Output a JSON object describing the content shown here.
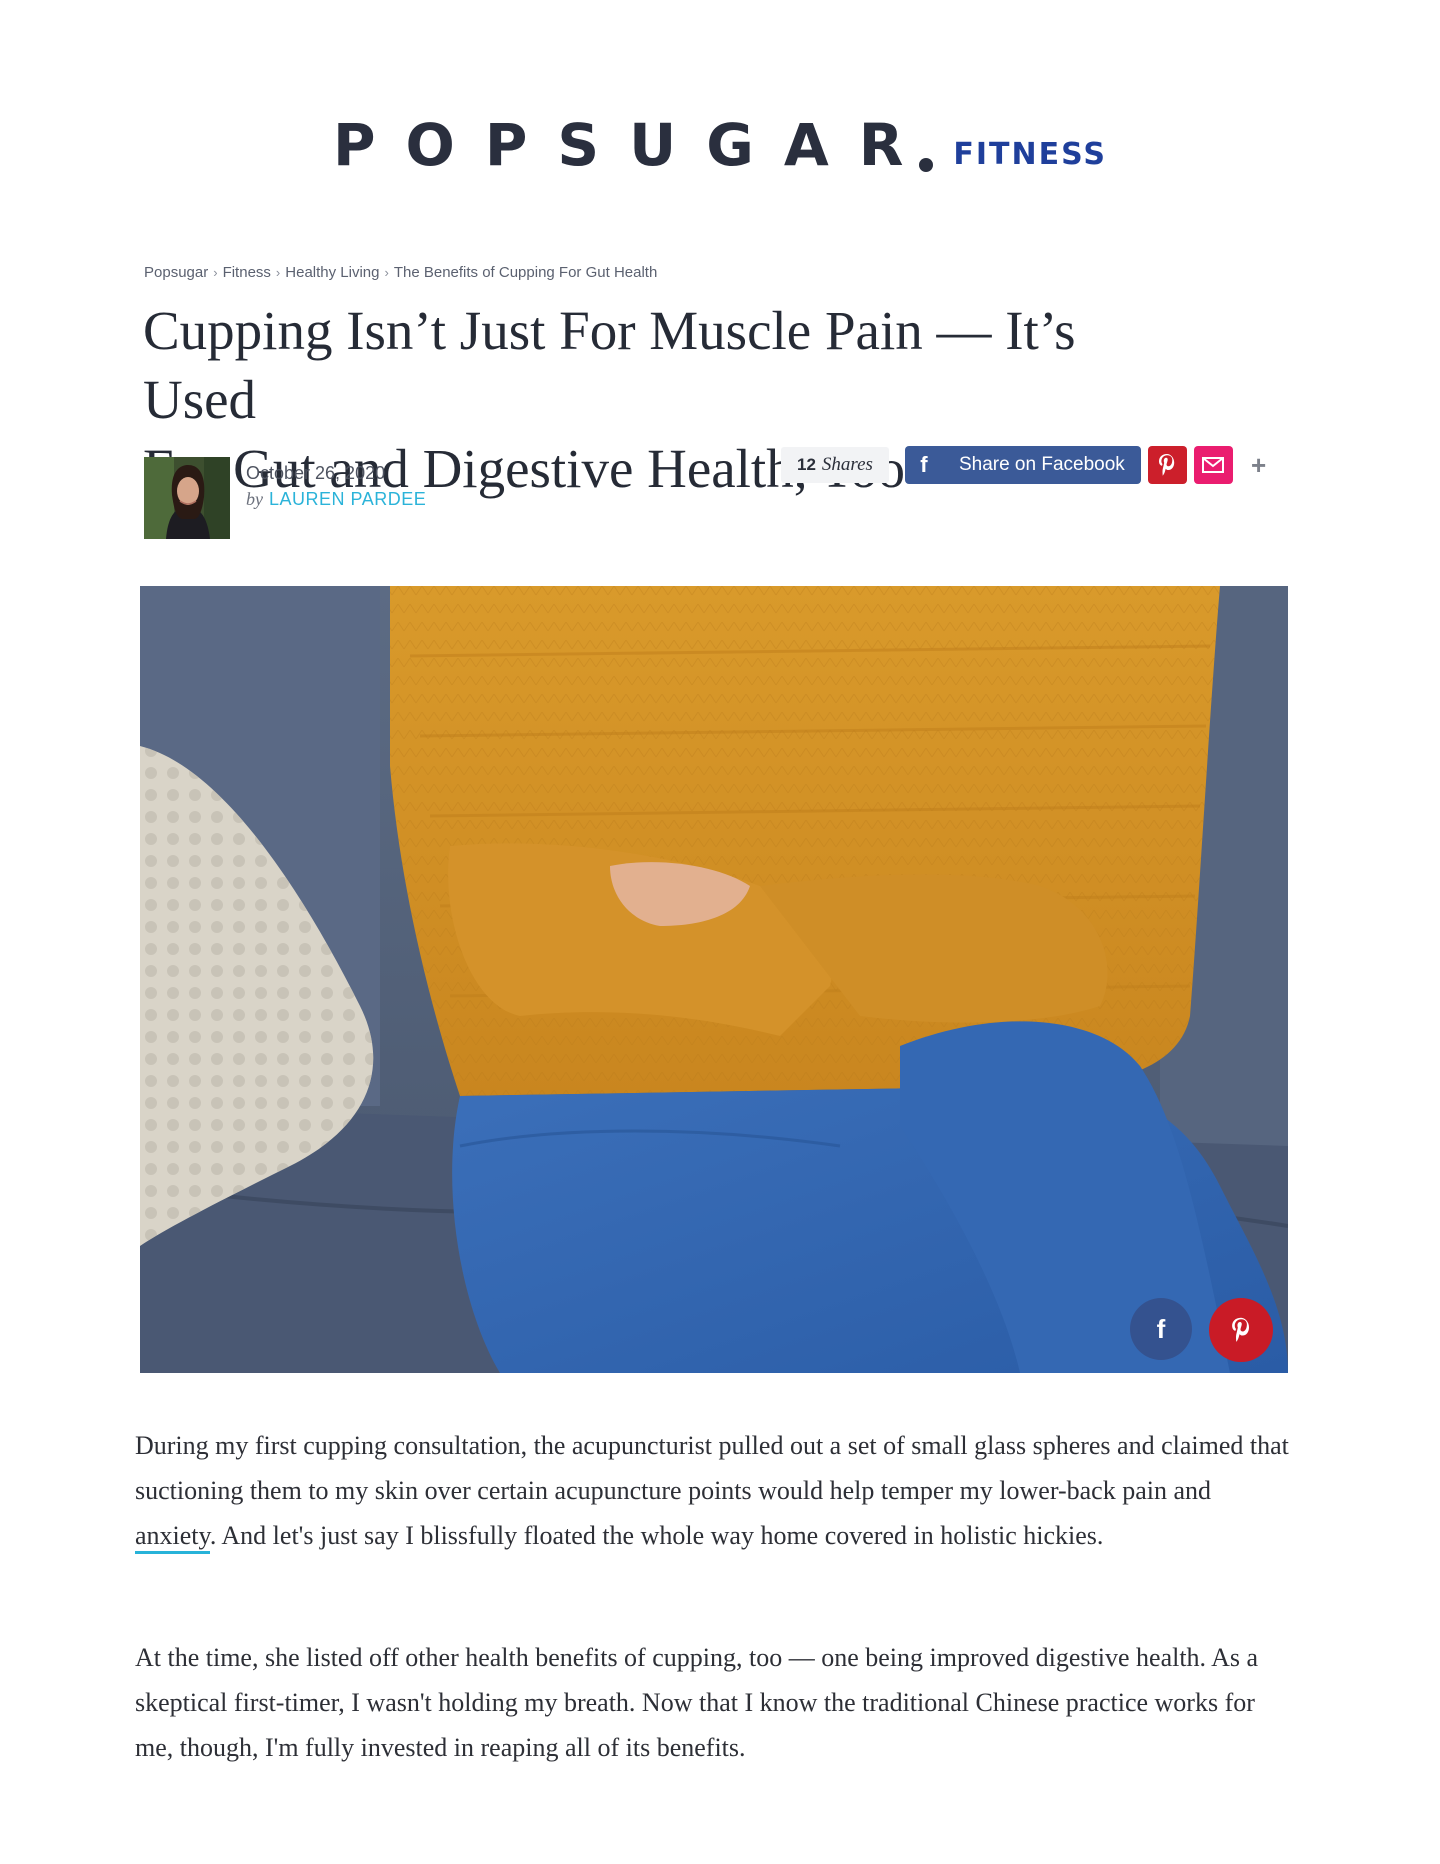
{
  "header": {
    "logo_main": "POPSUGAR",
    "logo_sub": "FITNESS"
  },
  "breadcrumb": [
    "Popsugar",
    "Fitness",
    "Healthy Living",
    "The Benefits of Cupping For Gut Health"
  ],
  "article": {
    "headline_line1": "Cupping Isn’t Just For Muscle Pain — It’s Used",
    "headline_line2": "For Gut and Digestive Health, Too",
    "date": "October 26, 2020",
    "by": "by",
    "author": "LAUREN PARDEE"
  },
  "share": {
    "count": "12",
    "count_label": "Shares",
    "facebook_label": "Share on Facebook",
    "more": "+"
  },
  "body": {
    "p1_before": "During my first cupping consultation, the acupuncturist pulled out a set of small glass spheres and claimed that suctioning them to my skin over certain acupuncture points would help temper my lower-back pain and ",
    "p1_link": "anxiety",
    "p1_after": ". And let's just say I blissfully floated the whole way home covered in holistic hickies.",
    "p2": "At the time, she listed off other health benefits of cupping, too — one being improved digestive health. As a skeptical first-timer, I wasn't holding my breath. Now that I know the traditional Chinese practice works for me, though, I'm fully invested in reaping all of its benefits."
  },
  "colors": {
    "brand_navy": "#2a2f3e",
    "fitness_blue": "#1f3f9b",
    "author_link": "#2bb3d9",
    "facebook": "#3b5a98",
    "pinterest": "#cc1f2b",
    "email": "#ea1d6f"
  },
  "icons": [
    "facebook-icon",
    "pinterest-icon",
    "email-icon",
    "plus-icon"
  ]
}
